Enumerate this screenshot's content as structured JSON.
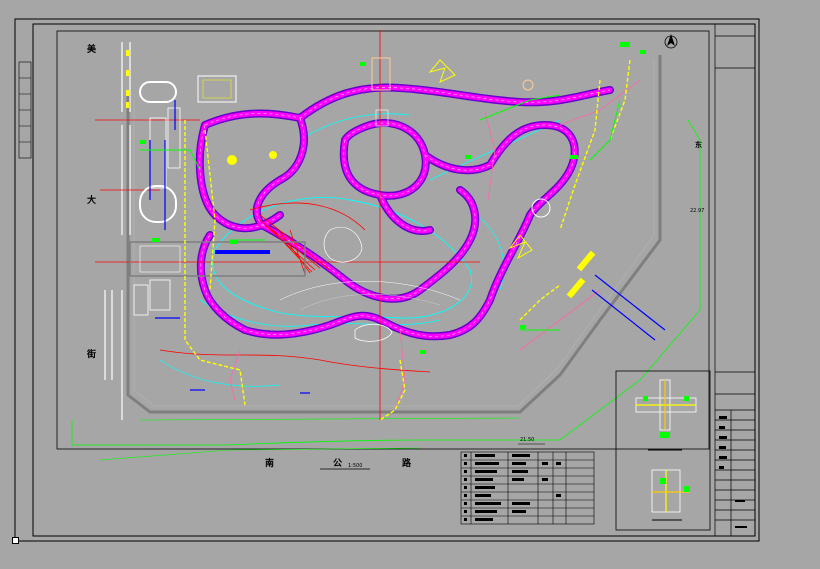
{
  "labels": {
    "street_west": [
      "美",
      "大",
      "街"
    ],
    "road_south": [
      "南",
      "公",
      "路"
    ],
    "scale_note": "1:500",
    "east_label": "东",
    "elev_1": "21.50",
    "elev_2": "22.97"
  },
  "colors": {
    "background": "#a6a6a6",
    "paper": "#ffffff",
    "path": "#ff00ff",
    "path_edge": "#6600cc",
    "water": "#00ffff",
    "pipe_yellow": "#ffff00",
    "pipe_green": "#00ff00",
    "pipe_blue": "#0000ff",
    "axis_red": "#ff0000",
    "edge_gray": "#7f7f7f"
  },
  "legend_rows": 9,
  "title_block_rows": 12
}
